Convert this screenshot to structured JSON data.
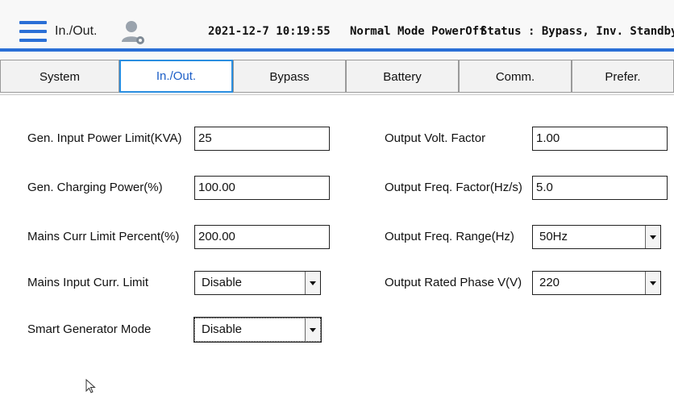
{
  "header": {
    "title": "In./Out.",
    "datetime": "2021-12-7 10:19:55",
    "mode": "Normal Mode  PowerOff",
    "status": "Status : Bypass, Inv. Standby",
    "accent_color": "#2a6fd6",
    "menu_icon": "hamburger-menu-icon",
    "user_icon": "user-settings-icon"
  },
  "tabs": [
    {
      "label": "System",
      "active": false
    },
    {
      "label": "In./Out.",
      "active": true
    },
    {
      "label": "Bypass",
      "active": false
    },
    {
      "label": "Battery",
      "active": false
    },
    {
      "label": "Comm.",
      "active": false
    },
    {
      "label": "Prefer.",
      "active": false
    }
  ],
  "form": {
    "left": [
      {
        "label": "Gen. Input Power Limit(KVA)",
        "type": "input",
        "value": "25"
      },
      {
        "label": "Gen. Charging Power(%)",
        "type": "input",
        "value": "100.00"
      },
      {
        "label": "Mains Curr Limit Percent(%)",
        "type": "input",
        "value": "200.00"
      },
      {
        "label": "Mains Input Curr. Limit",
        "type": "select",
        "value": "Disable"
      },
      {
        "label": "Smart Generator Mode",
        "type": "select",
        "value": "Disable"
      }
    ],
    "right": [
      {
        "label": "Output Volt. Factor",
        "type": "input",
        "value": "1.00"
      },
      {
        "label": "Output Freq. Factor(Hz/s)",
        "type": "input",
        "value": "5.0"
      },
      {
        "label": "Output Freq. Range(Hz)",
        "type": "select",
        "value": "50Hz"
      },
      {
        "label": "Output Rated Phase V(V)",
        "type": "select",
        "value": "220"
      }
    ]
  }
}
